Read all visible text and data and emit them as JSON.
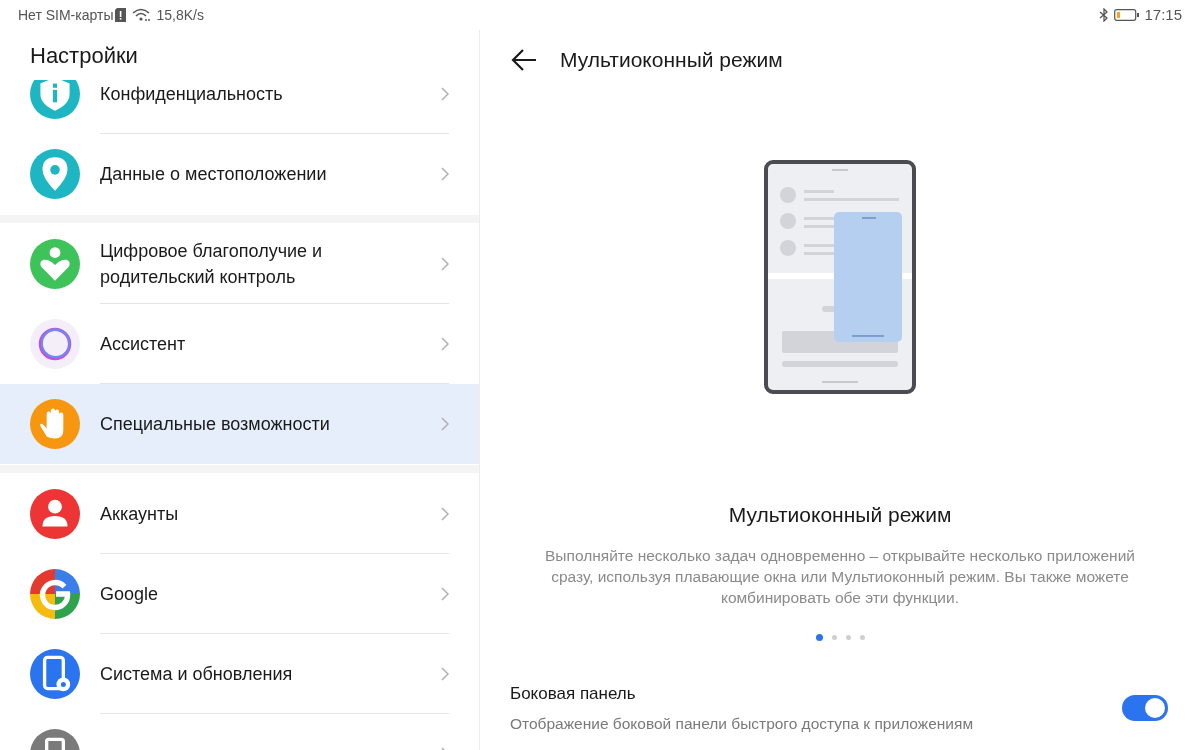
{
  "status_bar": {
    "carrier": "Нет SIM-карты",
    "speed": "15,8K/s",
    "time": "17:15"
  },
  "sidebar": {
    "title": "Настройки",
    "groups": [
      {
        "items": [
          {
            "label": "Конфиденциальность",
            "selected": false
          },
          {
            "label": "Данные о местоположении",
            "selected": false
          }
        ]
      },
      {
        "items": [
          {
            "label": "Цифровое благополучие и родительский контроль",
            "selected": false
          },
          {
            "label": "Ассистент",
            "selected": false
          },
          {
            "label": "Специальные возможности",
            "selected": true
          }
        ]
      },
      {
        "items": [
          {
            "label": "Аккаунты",
            "selected": false
          },
          {
            "label": "Google",
            "selected": false
          },
          {
            "label": "Система и обновления",
            "selected": false
          },
          {
            "selected": false
          }
        ]
      }
    ]
  },
  "detail": {
    "title": "Мультиоконный режим",
    "feature_title": "Мультиоконный режим",
    "description": "Выполняйте несколько задач одновременно – открывайте несколько приложений сразу, используя плавающие окна или Мультиоконный режим. Вы также можете комбинировать обе эти функции.",
    "pages": [
      {
        "selected": true
      },
      {
        "selected": false
      },
      {
        "selected": false
      },
      {
        "selected": false
      }
    ],
    "setting": {
      "title": "Боковая панель",
      "subtitle": "Отображение боковой панели быстрого доступа к приложениям",
      "on": true
    }
  }
}
